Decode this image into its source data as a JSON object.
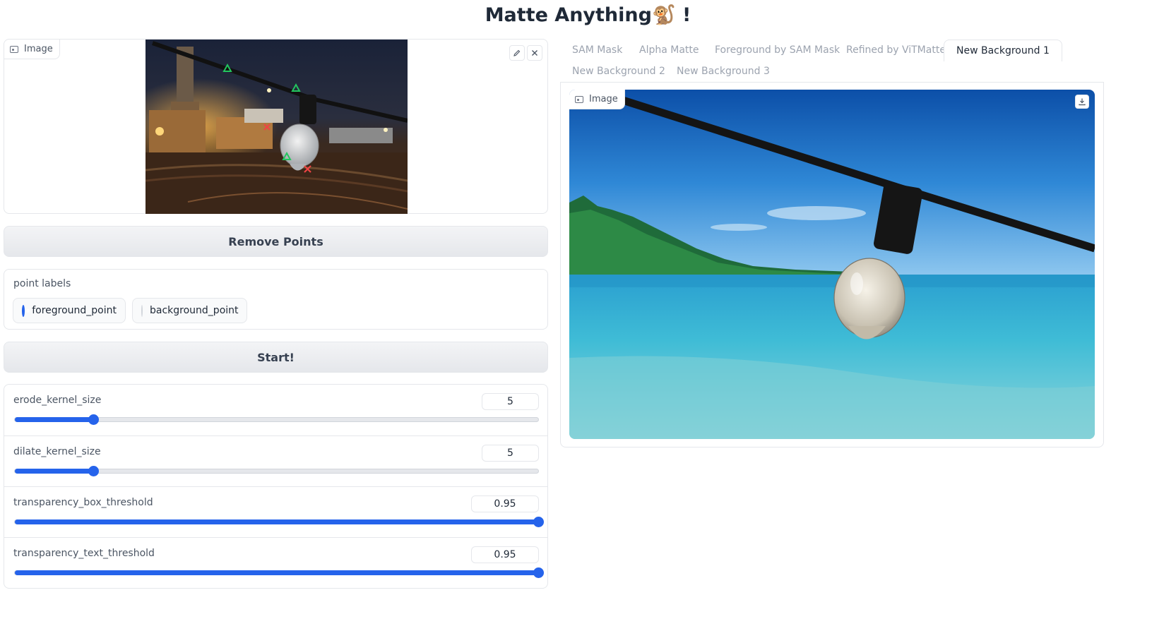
{
  "app": {
    "title": "Matte Anything🐒 !"
  },
  "input_image": {
    "label": "Image",
    "edit_icon": "pencil-icon",
    "clear_icon": "close-icon"
  },
  "buttons": {
    "remove_points": "Remove Points",
    "start": "Start!"
  },
  "point_labels": {
    "label": "point labels",
    "options": [
      {
        "label": "foreground_point",
        "selected": true
      },
      {
        "label": "background_point",
        "selected": false
      }
    ]
  },
  "sliders": [
    {
      "label": "erode_kernel_size",
      "value": "5",
      "fraction": 0.15
    },
    {
      "label": "dilate_kernel_size",
      "value": "5",
      "fraction": 0.15
    },
    {
      "label": "transparency_box_threshold",
      "value": "0.95",
      "fraction": 1.0
    },
    {
      "label": "transparency_text_threshold",
      "value": "0.95",
      "fraction": 1.0
    }
  ],
  "tabs": [
    {
      "label": "SAM Mask",
      "active": false
    },
    {
      "label": "Alpha Matte",
      "active": false
    },
    {
      "label": "Foreground by SAM Mask",
      "active": false
    },
    {
      "label": "Refined by ViTMatte",
      "active": false
    },
    {
      "label": "New Background 1",
      "active": true
    },
    {
      "label": "New Background 2",
      "active": false
    },
    {
      "label": "New Background 3",
      "active": false
    }
  ],
  "output_image": {
    "label": "Image",
    "download_icon": "download-icon"
  },
  "colors": {
    "accent": "#2563eb",
    "fg_marker": "#22c55e",
    "bg_marker": "#ef4444"
  }
}
